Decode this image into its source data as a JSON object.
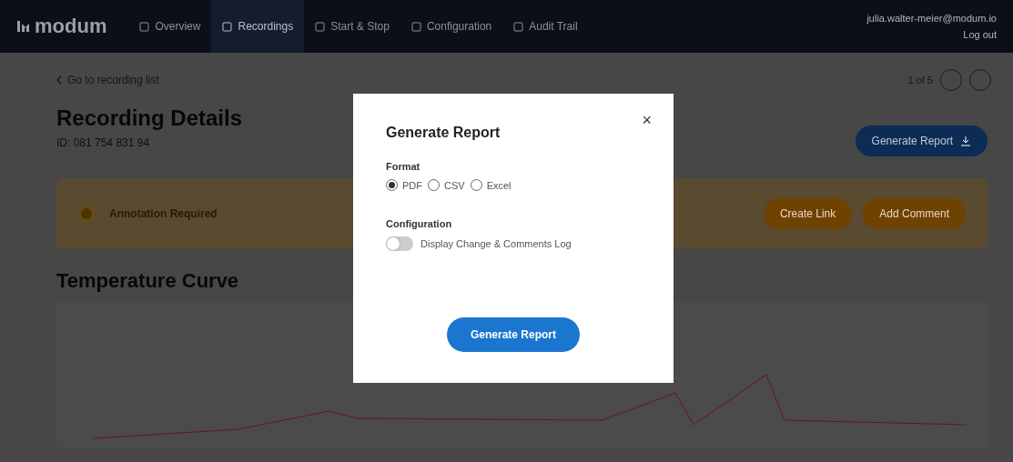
{
  "header": {
    "logo": "modum",
    "nav": [
      {
        "label": "Overview",
        "selected": false
      },
      {
        "label": "Recordings",
        "selected": true
      },
      {
        "label": "Start & Stop",
        "selected": false
      },
      {
        "label": "Configuration",
        "selected": false
      },
      {
        "label": "Audit Trail",
        "selected": false
      }
    ],
    "user": {
      "email": "julia.walter-meier@modum.io",
      "action": "Log out"
    }
  },
  "page": {
    "back_link": "Go to recording list",
    "pager": "1 of 5",
    "title": "Recording Details",
    "id": "ID: 081 754 831 94",
    "generate_button": "Generate Report",
    "warning": {
      "title": "Annotation Required",
      "buttons": [
        "Create Link",
        "Add Comment"
      ]
    },
    "chart_title": "Temperature Curve"
  },
  "dialog": {
    "title": "Generate Report",
    "format_label": "Format",
    "formats": [
      {
        "label": "PDF",
        "selected": true
      },
      {
        "label": "CSV",
        "selected": false
      },
      {
        "label": "Excel",
        "selected": false
      }
    ],
    "config_label": "Configuration",
    "toggle": {
      "label": "Display Change & Comments Log",
      "on": false
    },
    "submit": "Generate Report",
    "close": "×"
  }
}
